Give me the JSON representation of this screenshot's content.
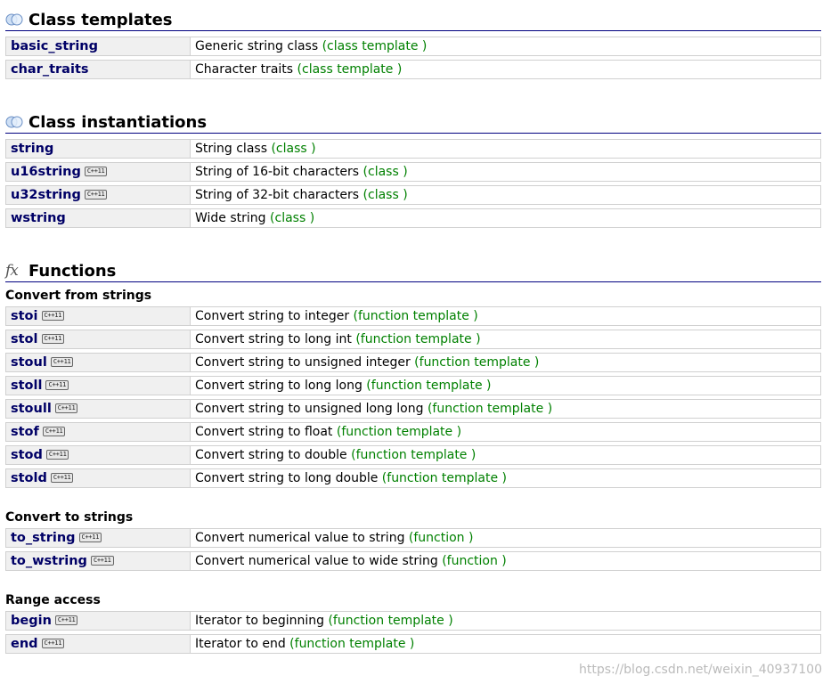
{
  "sections": {
    "class_templates": {
      "title": "Class templates",
      "icon": "class-icon",
      "rows": [
        {
          "name": "basic_string",
          "desc": "Generic string class",
          "kind": "(class template )",
          "cpp11": false
        },
        {
          "name": "char_traits",
          "desc": "Character traits",
          "kind": "(class template )",
          "cpp11": false
        }
      ]
    },
    "class_instantiations": {
      "title": "Class instantiations",
      "icon": "class-icon",
      "rows": [
        {
          "name": "string",
          "desc": "String class",
          "kind": "(class )",
          "cpp11": false
        },
        {
          "name": "u16string",
          "desc": "String of 16-bit characters",
          "kind": "(class )",
          "cpp11": true
        },
        {
          "name": "u32string",
          "desc": "String of 32-bit characters",
          "kind": "(class )",
          "cpp11": true
        },
        {
          "name": "wstring",
          "desc": "Wide string",
          "kind": "(class )",
          "cpp11": false
        }
      ]
    },
    "functions": {
      "title": "Functions",
      "icon": "fx-icon",
      "icon_glyph": "fx",
      "groups": [
        {
          "heading": "Convert from strings",
          "rows": [
            {
              "name": "stoi",
              "desc": "Convert string to integer",
              "kind": "(function template )",
              "cpp11": true
            },
            {
              "name": "stol",
              "desc": "Convert string to long int",
              "kind": "(function template )",
              "cpp11": true
            },
            {
              "name": "stoul",
              "desc": "Convert string to unsigned integer",
              "kind": "(function template )",
              "cpp11": true
            },
            {
              "name": "stoll",
              "desc": "Convert string to long long",
              "kind": "(function template )",
              "cpp11": true
            },
            {
              "name": "stoull",
              "desc": "Convert string to unsigned long long",
              "kind": "(function template )",
              "cpp11": true
            },
            {
              "name": "stof",
              "desc": "Convert string to float",
              "kind": "(function template )",
              "cpp11": true
            },
            {
              "name": "stod",
              "desc": "Convert string to double",
              "kind": "(function template )",
              "cpp11": true
            },
            {
              "name": "stold",
              "desc": "Convert string to long double",
              "kind": "(function template )",
              "cpp11": true
            }
          ]
        },
        {
          "heading": "Convert to strings",
          "rows": [
            {
              "name": "to_string",
              "desc": "Convert numerical value to string",
              "kind": "(function )",
              "cpp11": true
            },
            {
              "name": "to_wstring",
              "desc": "Convert numerical value to wide string",
              "kind": "(function )",
              "cpp11": true
            }
          ]
        },
        {
          "heading": "Range access",
          "rows": [
            {
              "name": "begin",
              "desc": "Iterator to beginning",
              "kind": "(function template )",
              "cpp11": true
            },
            {
              "name": "end",
              "desc": "Iterator to end",
              "kind": "(function template )",
              "cpp11": true
            }
          ]
        }
      ]
    }
  },
  "badge_label": "C++11",
  "watermark": "https://blog.csdn.net/weixin_40937100",
  "colors": {
    "link": "#000066",
    "kind": "#008000",
    "rule": "#000080",
    "name_cell_bg": "#f0f0f0",
    "cell_border": "#d0d0d0"
  }
}
